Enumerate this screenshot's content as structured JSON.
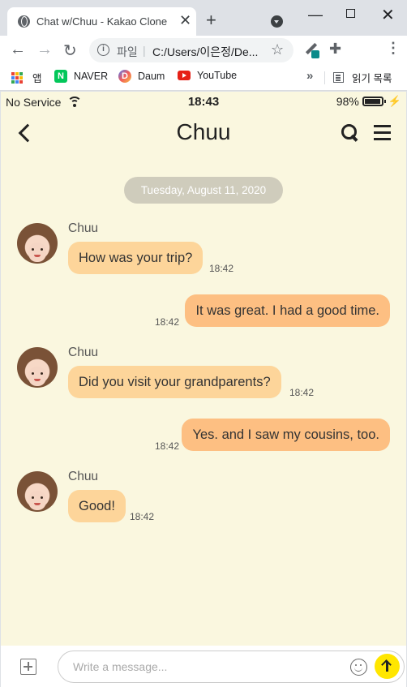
{
  "browser": {
    "tab_title": "Chat w/Chuu - Kakao Clone",
    "address_label": "파일",
    "address_url": "C:/Users/이은정/De...",
    "bookmarks": [
      {
        "label": "앱",
        "icon": "apps-grid-icon"
      },
      {
        "label": "NAVER",
        "icon": "naver-icon"
      },
      {
        "label": "Daum",
        "icon": "daum-icon"
      },
      {
        "label": "YouTube",
        "icon": "youtube-icon"
      }
    ],
    "reading_list": "읽기 목록",
    "more_bookmarks": "»"
  },
  "status_bar": {
    "carrier": "No Service",
    "time": "18:43",
    "battery": "98%"
  },
  "header": {
    "title": "Chuu"
  },
  "date_divider": "Tuesday, August 11, 2020",
  "messages": [
    {
      "direction": "in",
      "sender": "Chuu",
      "text": "How was your trip?",
      "time": "18:42"
    },
    {
      "direction": "out",
      "text": "It was great. I had a good time.",
      "time": "18:42"
    },
    {
      "direction": "in",
      "sender": "Chuu",
      "text": "Did you visit your grandparents?",
      "time": "18:42"
    },
    {
      "direction": "out",
      "text": "Yes. and I saw my cousins, too.",
      "time": "18:42"
    },
    {
      "direction": "in",
      "sender": "Chuu",
      "text": "Good!",
      "time": "18:42"
    }
  ],
  "composer": {
    "placeholder": "Write a message..."
  },
  "colors": {
    "background": "#faf7df",
    "incoming_bubble": "#fdd59a",
    "outgoing_bubble": "#fdbf82",
    "send_button": "#ffe600",
    "date_pill": "#cfccbc"
  }
}
